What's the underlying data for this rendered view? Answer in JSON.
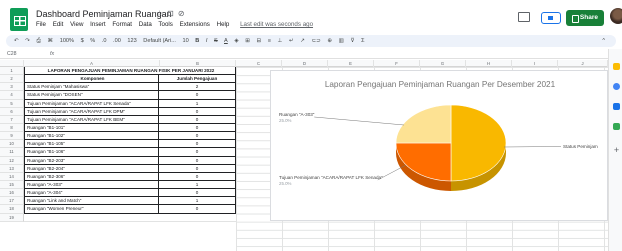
{
  "title_bar": {
    "doc_title": "Dashboard Peminjaman Ruangan",
    "star_icon": "star-icon",
    "move_icon": "folder-icon",
    "cloud_icon": "cloud-icon",
    "share_label": "Share"
  },
  "menu": {
    "items": [
      "File",
      "Edit",
      "View",
      "Insert",
      "Format",
      "Data",
      "Tools",
      "Extensions",
      "Help"
    ],
    "last_edit": "Last edit was seconds ago"
  },
  "toolbar": {
    "zoom": "100%",
    "currency": "$",
    "percent": "%",
    "decimal_less": ".0",
    "decimal_more": ".00",
    "number_format": "123",
    "font": "Default (Ari...",
    "font_size": "10"
  },
  "formula_bar": {
    "cell_ref": "C28",
    "fx": "fx"
  },
  "columns": [
    "A",
    "B",
    "C",
    "D",
    "E",
    "F",
    "G",
    "H",
    "I",
    "J"
  ],
  "table": {
    "title": "LAPORAN PENGAJUAN PEMINJAMAN RUANGAN FISIK PER JANUARI 2022",
    "headers": [
      "Komponen",
      "Jumlah Pengajuan"
    ],
    "rows": [
      {
        "label": "Status Peminjam \"Mahasiswa\"",
        "value": "2"
      },
      {
        "label": "Status Peminjam \"DOSEN\"",
        "value": "0"
      },
      {
        "label": "Tujuan Peminjaman \"ACARA/RAPAT LFK Senada\"",
        "value": "1"
      },
      {
        "label": "Tujuan Peminjaman \"ACARA/RAPAT LFK DPM\"",
        "value": "0"
      },
      {
        "label": "Tujuan Peminjaman \"ACARA/RAPAT LFK BEM\"",
        "value": "0"
      },
      {
        "label": "Ruangan \"B1-101\"",
        "value": "0"
      },
      {
        "label": "Ruangan \"B1-102\"",
        "value": "0"
      },
      {
        "label": "Ruangan \"B1-105\"",
        "value": "0"
      },
      {
        "label": "Ruangan \"B1-106\"",
        "value": "0"
      },
      {
        "label": "Ruangan \"B2-203\"",
        "value": "0"
      },
      {
        "label": "Ruangan \"B2-204\"",
        "value": "0"
      },
      {
        "label": "Ruangan \"B2-306\"",
        "value": "0"
      },
      {
        "label": "Ruangan \"A-303\"",
        "value": "1"
      },
      {
        "label": "Ruangan \"A-304\"",
        "value": "0"
      },
      {
        "label": "Ruangan \"Link and Match\"",
        "value": "1"
      },
      {
        "label": "Ruangan \"Women Preneur\"",
        "value": "0"
      }
    ]
  },
  "chart_data": {
    "type": "pie",
    "title": "Laporan Pengajuan Peminjaman Ruangan Per Desember 2021",
    "slices": [
      {
        "label": "Status Peminjam",
        "value": 50,
        "color": "#f9b800"
      },
      {
        "label": "Tujuan Peminjaman \"ACARA/RAPAT LFK Senada\"",
        "value": 25,
        "pct_label": "25.0%",
        "color": "#ff6d00"
      },
      {
        "label": "Ruangan \"A-303\"",
        "value": 25,
        "pct_label": "25.0%",
        "color": "#fde293"
      }
    ],
    "legend": "none"
  },
  "colors": {
    "share": "#188038",
    "accent": "#1a73e8",
    "sheets_green": "#0f9d58"
  }
}
